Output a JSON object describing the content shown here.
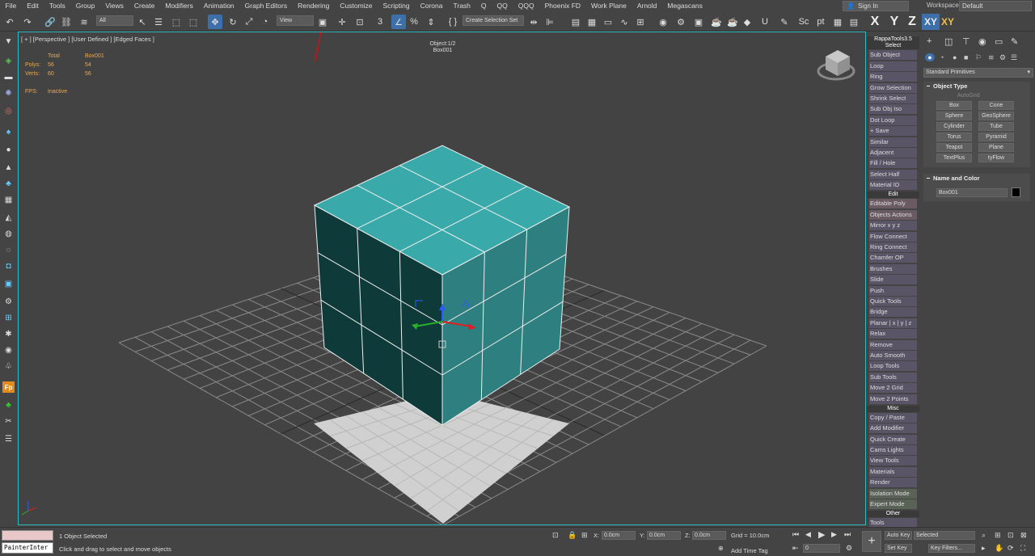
{
  "menu": [
    "File",
    "Edit",
    "Tools",
    "Group",
    "Views",
    "Create",
    "Modifiers",
    "Animation",
    "Graph Editors",
    "Rendering",
    "Customize",
    "Scripting",
    "Corona",
    "Trash",
    "Q",
    "QQ",
    "QQQ",
    "Phoenix FD",
    "Work Plane",
    "Arnold",
    "Megascans"
  ],
  "signin": "Sign In",
  "workspaces": {
    "label": "Workspaces:",
    "value": "Default"
  },
  "toolbar": {
    "filter_all": "All",
    "ref_coord": "View",
    "selection_set": "Create Selection Set",
    "axis_x": "X",
    "axis_y": "Y",
    "axis_z": "Z",
    "axis_xy": "XY",
    "axis_xy2": "XY"
  },
  "viewport": {
    "label": "[ + ] [Perspective ] [User Defined ] [Edged Faces ]",
    "object_line1": "Object:1/2",
    "object_line2": "Box001",
    "stats": {
      "total": "Total",
      "name": "Box001",
      "polys_label": "Polys:",
      "polys_total": "56",
      "polys_obj": "54",
      "verts_label": "Verts:",
      "verts_total": "60",
      "verts_obj": "56",
      "fps_label": "FPS:",
      "fps_value": "Inactive"
    },
    "colors": {
      "cube_top": "#3aa9a9",
      "cube_left": "#0f3a3a",
      "cube_right": "#2e7f80",
      "plane": "#d0d0d0",
      "grid": "#8a8a8a",
      "border": "#2fb9c0"
    }
  },
  "rappa": {
    "title": "RappaTools3.5",
    "sections": {
      "select": "Select",
      "edit": "Edit",
      "misc": "Misc",
      "other": "Other"
    },
    "select_items": [
      "Sub Object",
      "Loop",
      "Ring",
      "Grow Selection",
      "Shrink Select",
      "Sub Obj Iso",
      "Dot Loop",
      "+ Save",
      "Similar",
      "Adjacent",
      "Fill / Hole",
      "Select Half",
      "Material ID"
    ],
    "edit_items": [
      "Editable Poly",
      "Objects Actions",
      "Mirror    x   y   z",
      "Flow Connect",
      "Ring Connect",
      "Chamfer OP",
      "Brushes",
      "Slide",
      "Push",
      "Quick Tools",
      "Bridge",
      "Planar | x | y | z",
      "Relax",
      "Remove",
      "Auto Smooth",
      "Loop Tools",
      "Sub Tools",
      "Move 2 Grid",
      "Move 2 Points"
    ],
    "misc_items": [
      "Copy / Paste",
      "Add Modifier",
      "Quick Create",
      "Cams Lights",
      "View Tools",
      "Materials",
      "Render",
      "Isolation Mode",
      "Expert Mode"
    ],
    "other_items": [
      "Tools"
    ]
  },
  "command_panel": {
    "category": "Standard Primitives",
    "object_type_title": "Object Type",
    "autogrid": "AutoGrid",
    "objects": [
      "Box",
      "Cone",
      "Sphere",
      "GeoSphere",
      "Cylinder",
      "Tube",
      "Torus",
      "Pyramid",
      "Teapot",
      "Plane",
      "TextPlus",
      "tyFlow"
    ],
    "name_color_title": "Name and Color",
    "object_name": "Box001",
    "object_color": "#000000"
  },
  "statusbar": {
    "listener": "PainterInter",
    "selected": "1 Object Selected",
    "prompt": "Click and drag to select and move objects",
    "x_label": "X:",
    "x_value": "0.0cm",
    "y_label": "Y:",
    "y_value": "0.0cm",
    "z_label": "Z:",
    "z_value": "0.0cm",
    "grid": "Grid = 10.0cm",
    "add_time_tag": "Add Time Tag",
    "frame": "0",
    "auto_key": "Auto Key",
    "key_mode": "Selected",
    "set_key": "Set Key",
    "key_filters": "Key Filters..."
  }
}
